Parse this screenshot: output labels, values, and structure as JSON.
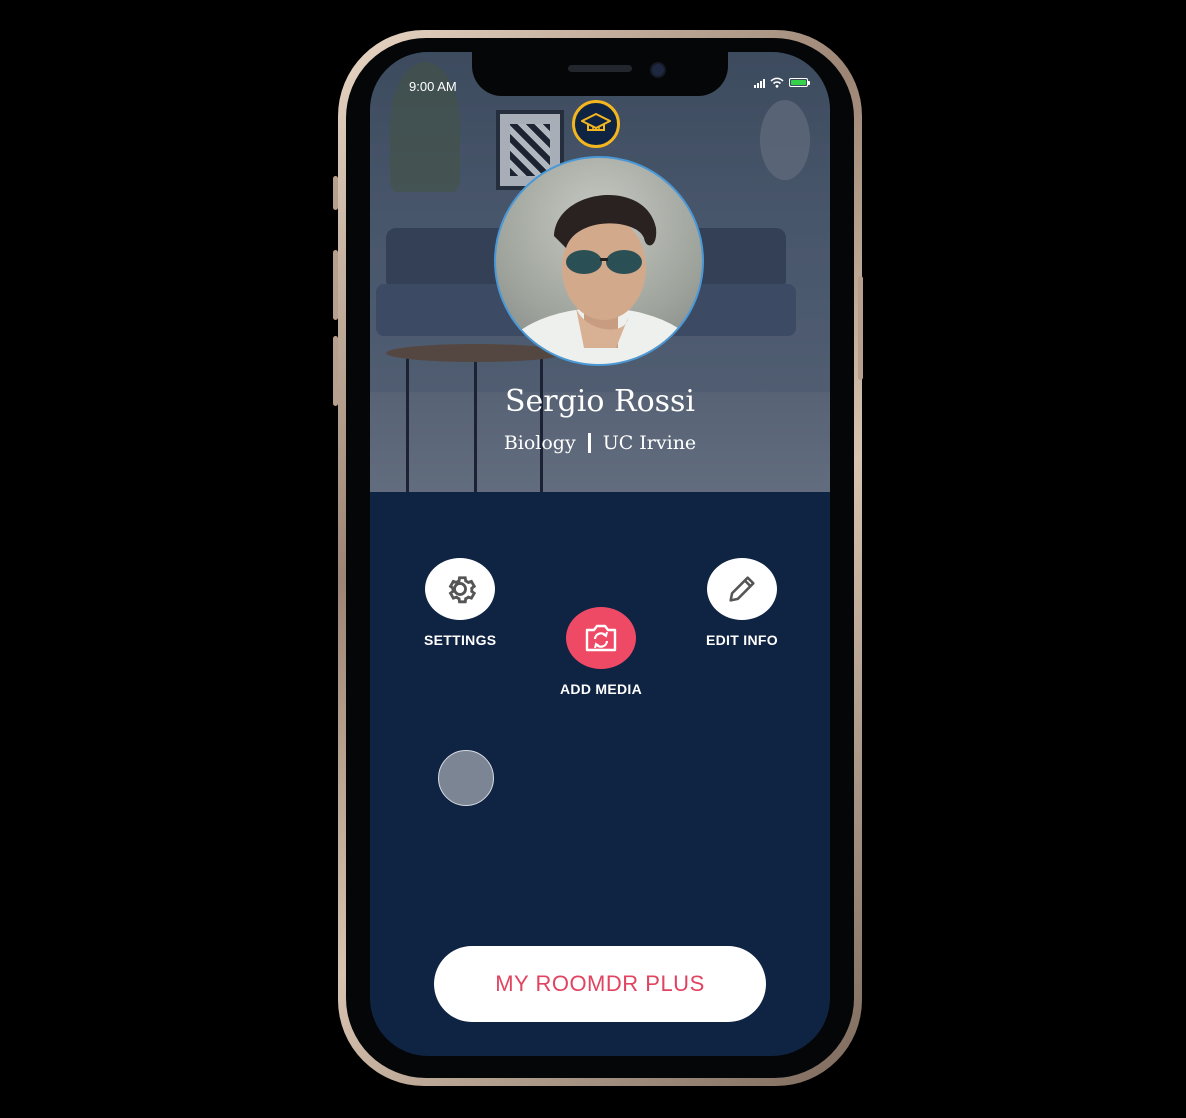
{
  "status_bar": {
    "time": "9:00 AM"
  },
  "profile": {
    "name": "Sergio Rossi",
    "major": "Biology",
    "school": "UC Irvine"
  },
  "actions": {
    "settings_label": "SETTINGS",
    "add_media_label": "ADD MEDIA",
    "edit_info_label": "EDIT INFO"
  },
  "cta": {
    "label": "MY ROOMDR PLUS"
  },
  "colors": {
    "screen_bg": "#0f2343",
    "accent_pink": "#ee4a66",
    "badge_gold": "#f3b61f",
    "avatar_ring": "#4a98d6",
    "battery_green": "#35d14a"
  },
  "icons": [
    "graduation-cap-icon",
    "gear-icon",
    "camera-rotate-icon",
    "pencil-icon",
    "signal-icon",
    "wifi-icon",
    "battery-icon"
  ]
}
